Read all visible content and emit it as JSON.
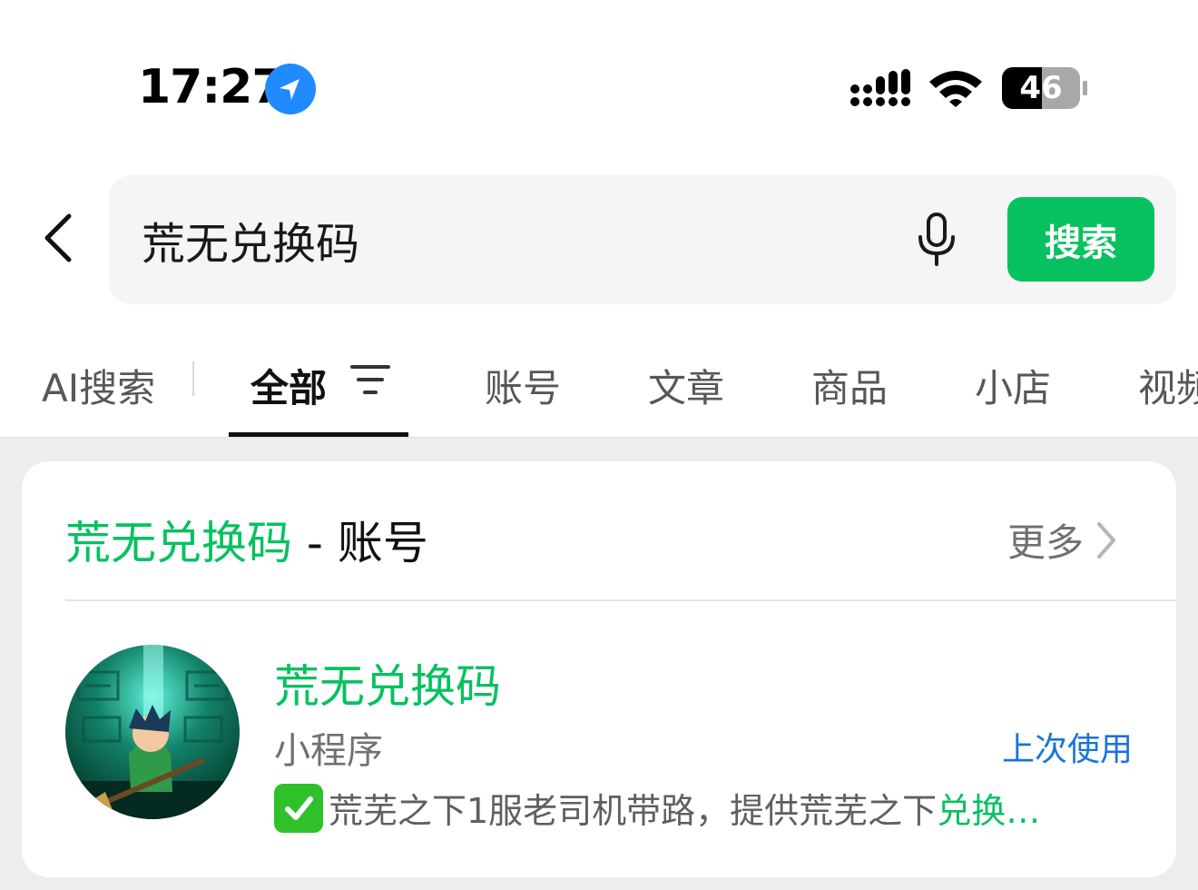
{
  "status_bar": {
    "time": "17:27",
    "battery": "46"
  },
  "search": {
    "query": "荒无兑换码",
    "button_label": "搜索"
  },
  "tabs": [
    {
      "label": "AI搜索"
    },
    {
      "label": "全部"
    },
    {
      "label": "账号"
    },
    {
      "label": "文章"
    },
    {
      "label": "商品"
    },
    {
      "label": "小店"
    },
    {
      "label": "视频"
    }
  ],
  "card": {
    "keyword": "荒无兑换码",
    "separator": " - ",
    "category": "账号",
    "more_label": "更多",
    "result": {
      "title": "荒无兑换码",
      "type": "小程序",
      "badge": "上次使用",
      "description_prefix": "荒芜之下1服老司机带路，提供荒芜之下",
      "description_keyword": "兑换…"
    }
  },
  "colors": {
    "accent": "#07c160",
    "link": "#1a73d9",
    "location": "#1f8bff"
  }
}
